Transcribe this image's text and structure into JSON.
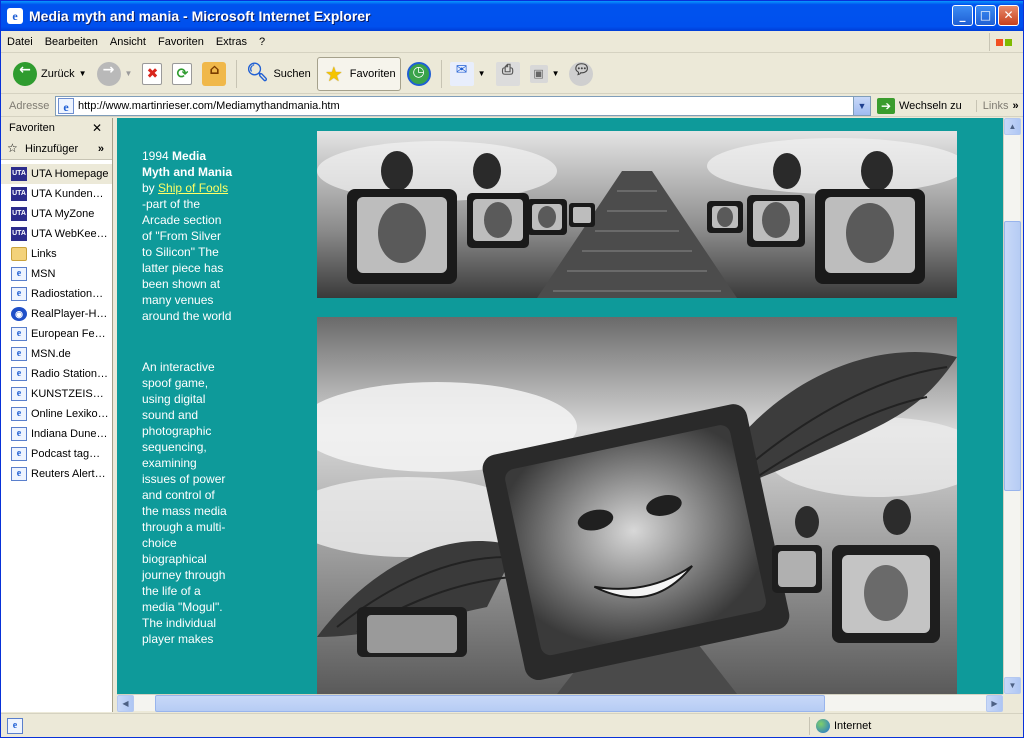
{
  "window": {
    "title": "Media myth and mania - Microsoft Internet Explorer"
  },
  "menu": [
    "Datei",
    "Bearbeiten",
    "Ansicht",
    "Favoriten",
    "Extras",
    "?"
  ],
  "toolbar": {
    "back": "Zurück",
    "search": "Suchen",
    "favorites": "Favoriten"
  },
  "address": {
    "label": "Adresse",
    "url": "http://www.martinrieser.com/Mediamythandmania.htm",
    "go": "Wechseln zu",
    "links": "Links"
  },
  "favorites_pane": {
    "title": "Favoriten",
    "add": "Hinzufüger",
    "items": [
      {
        "label": "UTA Homepage",
        "icon": "uta-icon"
      },
      {
        "label": "UTA Kunden…",
        "icon": "uta-icon"
      },
      {
        "label": "UTA MyZone",
        "icon": "uta-icon"
      },
      {
        "label": "UTA WebKee…",
        "icon": "uta-icon"
      },
      {
        "label": "Links",
        "icon": "folder-icon"
      },
      {
        "label": "MSN",
        "icon": "ie-page-icon"
      },
      {
        "label": "Radiostation…",
        "icon": "ie-page-icon"
      },
      {
        "label": "RealPlayer-H…",
        "icon": "realplayer-icon"
      },
      {
        "label": "European Fe…",
        "icon": "ie-page-icon"
      },
      {
        "label": "MSN.de",
        "icon": "ie-page-icon"
      },
      {
        "label": "Radio Station…",
        "icon": "ie-page-icon"
      },
      {
        "label": "KUNSTZEISC…",
        "icon": "ie-page-icon"
      },
      {
        "label": "Online Lexiko…",
        "icon": "ie-page-icon"
      },
      {
        "label": "Indiana Dune…",
        "icon": "ie-page-icon"
      },
      {
        "label": "Podcast tag…",
        "icon": "ie-page-icon"
      },
      {
        "label": "Reuters Alert…",
        "icon": "ie-page-icon"
      }
    ]
  },
  "page": {
    "year": "1994",
    "title": "Media Myth and Mania",
    "by": "by",
    "link": "Ship of Fools",
    "intro": "-part of the Arcade section of \"From Silver to Silicon\" The latter piece has been shown at many venues around the world",
    "description": "An interactive spoof game, using digital sound and photographic sequencing, examining issues of power and control of the mass media through a multi-choice biographical journey through the life of a media \"Mogul\". The individual player makes"
  },
  "status": {
    "zone": "Internet"
  }
}
